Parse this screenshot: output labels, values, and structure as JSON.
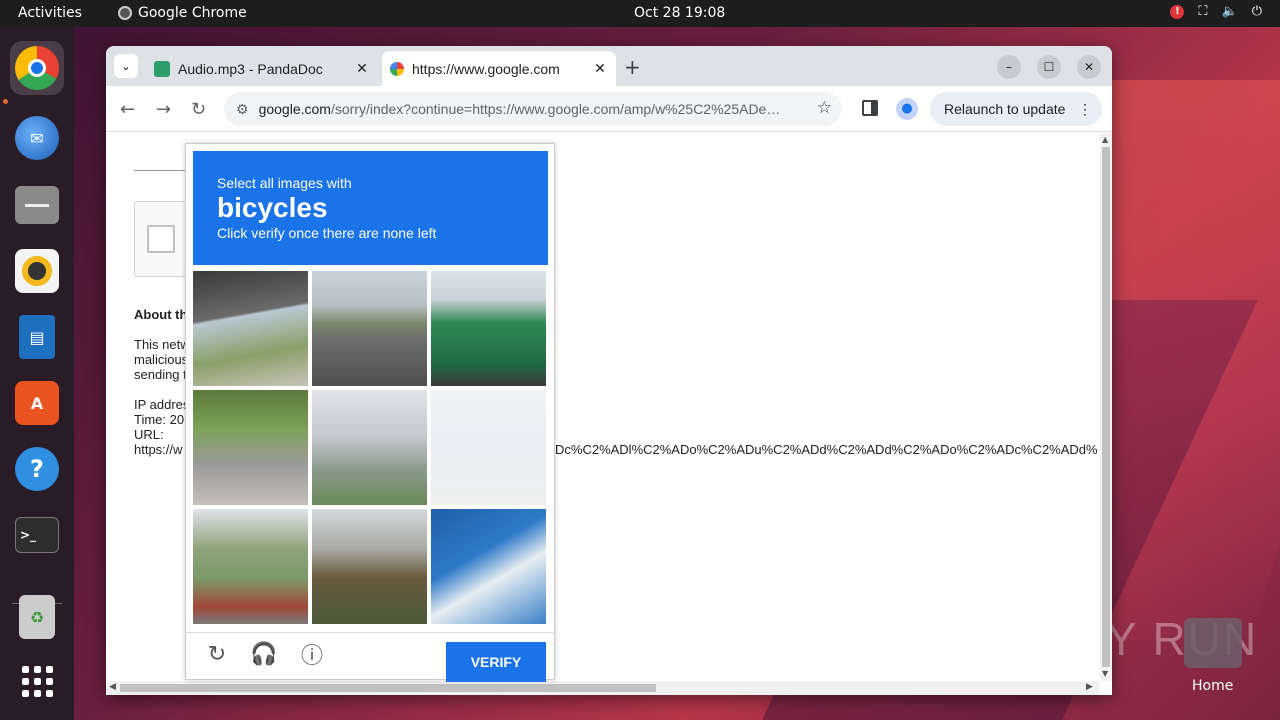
{
  "topbar": {
    "activities": "Activities",
    "app_name": "Google Chrome",
    "clock": "Oct 28  19:08"
  },
  "dock": {
    "items": [
      "chrome-icon",
      "thunderbird-icon",
      "files-icon",
      "rhythmbox-icon",
      "writer-icon",
      "app-center-icon",
      "help-icon",
      "terminal-icon",
      "trash-icon",
      "show-apps-icon"
    ]
  },
  "desktop": {
    "home_label": "Home",
    "watermark": "ANY RUN"
  },
  "browser": {
    "tabs": [
      {
        "title": "Audio.mp3 - PandaDoc",
        "close": "✕"
      },
      {
        "title": "https://www.google.com",
        "close": "✕"
      }
    ],
    "new_tab": "+",
    "url_host": "google.com",
    "url_path": "/sorry/index?continue=https://www.google.com/amp/w%25C2%25ADe…",
    "relaunch": "Relaunch to update"
  },
  "page": {
    "about": "About th",
    "para": [
      "This netw",
      "malicious",
      "sending t"
    ],
    "ip_line": "IP addres",
    "time_line": "Time: 20",
    "url_label": "URL:",
    "url_start": "https://w",
    "url_tail": "Dc%C2%ADl%C2%ADo%C2%ADu%C2%ADd%C2%ADd%C2%ADo%C2%ADc%C2%ADd%"
  },
  "captcha": {
    "line1": "Select all images with",
    "keyword": "bicycles",
    "line3": "Click verify once there are none left",
    "verify": "VERIFY"
  },
  "colors": {
    "accent": "#1a73e8",
    "topbar": "#1d1d1d",
    "dock": "#2a1c27"
  }
}
